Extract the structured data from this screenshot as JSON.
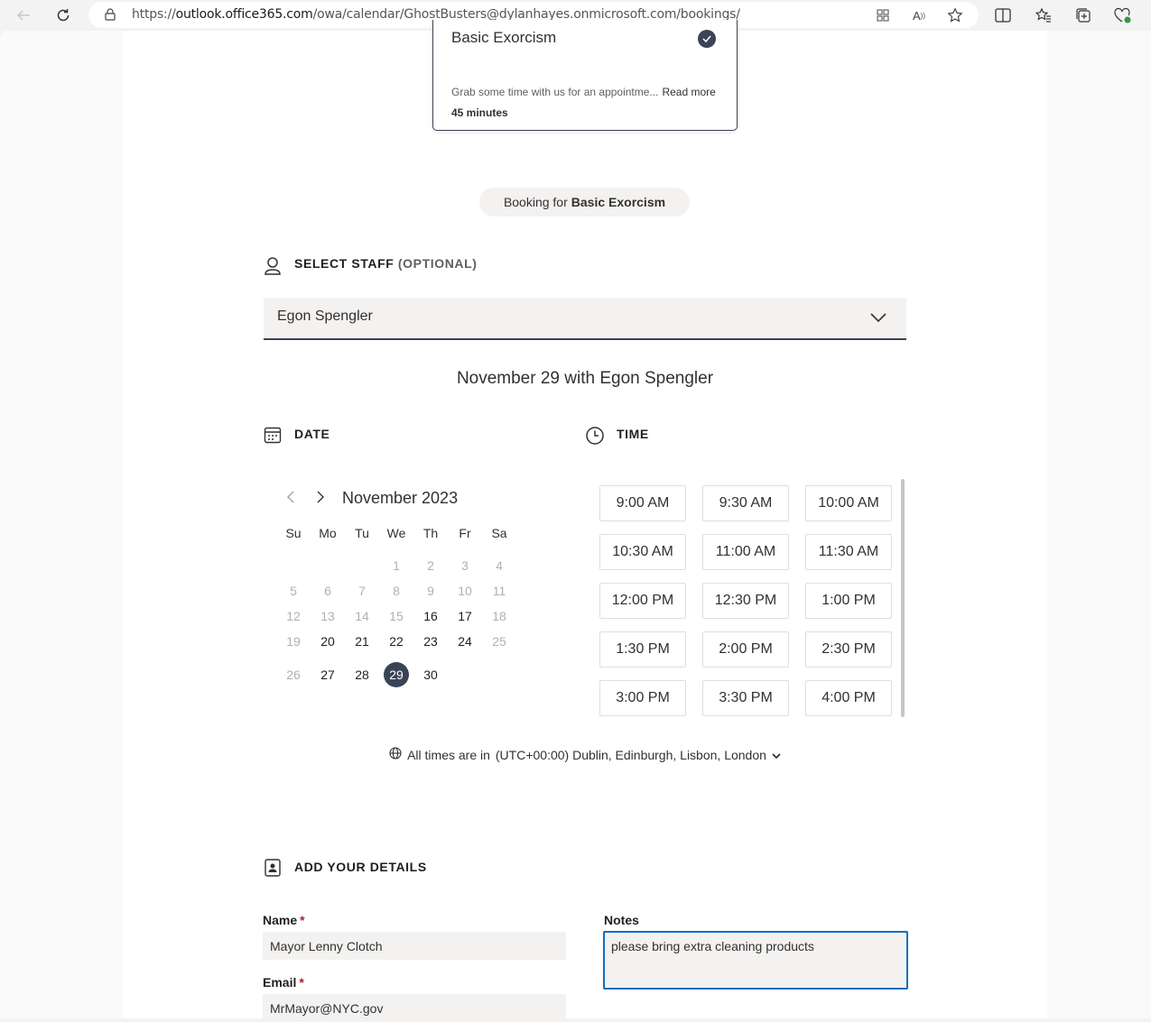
{
  "browser": {
    "url_prefix": "https://",
    "url_host": "outlook.office365.com",
    "url_path": "/owa/calendar/GhostBusters@dylanhayes.onmicrosoft.com/bookings/"
  },
  "service": {
    "title": "Basic Exorcism",
    "description": "Grab some time with us for an appointme...",
    "read_more": "Read more",
    "duration": "45 minutes"
  },
  "booking_pill": {
    "prefix": "Booking for",
    "service": "Basic Exorcism"
  },
  "staff": {
    "heading": "SELECT STAFF",
    "optional": "(OPTIONAL)",
    "selected": "Egon Spengler"
  },
  "summary_heading": "November 29 with Egon Spengler",
  "date_section": {
    "heading": "DATE"
  },
  "time_section": {
    "heading": "TIME"
  },
  "calendar": {
    "month_label": "November 2023",
    "weekdays": [
      "Su",
      "Mo",
      "Tu",
      "We",
      "Th",
      "Fr",
      "Sa"
    ],
    "weeks": [
      [
        null,
        null,
        null,
        {
          "d": "1",
          "s": "dis"
        },
        {
          "d": "2",
          "s": "dis"
        },
        {
          "d": "3",
          "s": "dis"
        },
        {
          "d": "4",
          "s": "dis"
        }
      ],
      [
        {
          "d": "5",
          "s": "dis"
        },
        {
          "d": "6",
          "s": "dis"
        },
        {
          "d": "7",
          "s": "dis"
        },
        {
          "d": "8",
          "s": "dis"
        },
        {
          "d": "9",
          "s": "dis"
        },
        {
          "d": "10",
          "s": "dis"
        },
        {
          "d": "11",
          "s": "dis"
        }
      ],
      [
        {
          "d": "12",
          "s": "dis"
        },
        {
          "d": "13",
          "s": "dis"
        },
        {
          "d": "14",
          "s": "dis"
        },
        {
          "d": "15",
          "s": "dis"
        },
        {
          "d": "16",
          "s": "en"
        },
        {
          "d": "17",
          "s": "en"
        },
        {
          "d": "18",
          "s": "dis"
        }
      ],
      [
        {
          "d": "19",
          "s": "dis"
        },
        {
          "d": "20",
          "s": "en"
        },
        {
          "d": "21",
          "s": "en"
        },
        {
          "d": "22",
          "s": "en"
        },
        {
          "d": "23",
          "s": "en"
        },
        {
          "d": "24",
          "s": "en"
        },
        {
          "d": "25",
          "s": "dis"
        }
      ],
      [
        {
          "d": "26",
          "s": "dis"
        },
        {
          "d": "27",
          "s": "en"
        },
        {
          "d": "28",
          "s": "en"
        },
        {
          "d": "29",
          "s": "sel"
        },
        {
          "d": "30",
          "s": "en"
        },
        null,
        null
      ]
    ]
  },
  "time_slots": [
    "9:00 AM",
    "9:30 AM",
    "10:00 AM",
    "10:30 AM",
    "11:00 AM",
    "11:30 AM",
    "12:00 PM",
    "12:30 PM",
    "1:00 PM",
    "1:30 PM",
    "2:00 PM",
    "2:30 PM",
    "3:00 PM",
    "3:30 PM",
    "4:00 PM"
  ],
  "timezone": {
    "prefix": "All times are in",
    "value": "(UTC+00:00) Dublin, Edinburgh, Lisbon, London"
  },
  "details": {
    "heading": "ADD YOUR DETAILS",
    "name_label": "Name",
    "name_value": "Mayor Lenny Clotch",
    "email_label": "Email",
    "email_value": "MrMayor@NYC.gov",
    "notes_label": "Notes",
    "notes_value": "please bring extra cleaning products",
    "required_mark": "*"
  },
  "colors": {
    "accent_dark": "#3b4456",
    "focus_blue": "#0f6cbd"
  }
}
